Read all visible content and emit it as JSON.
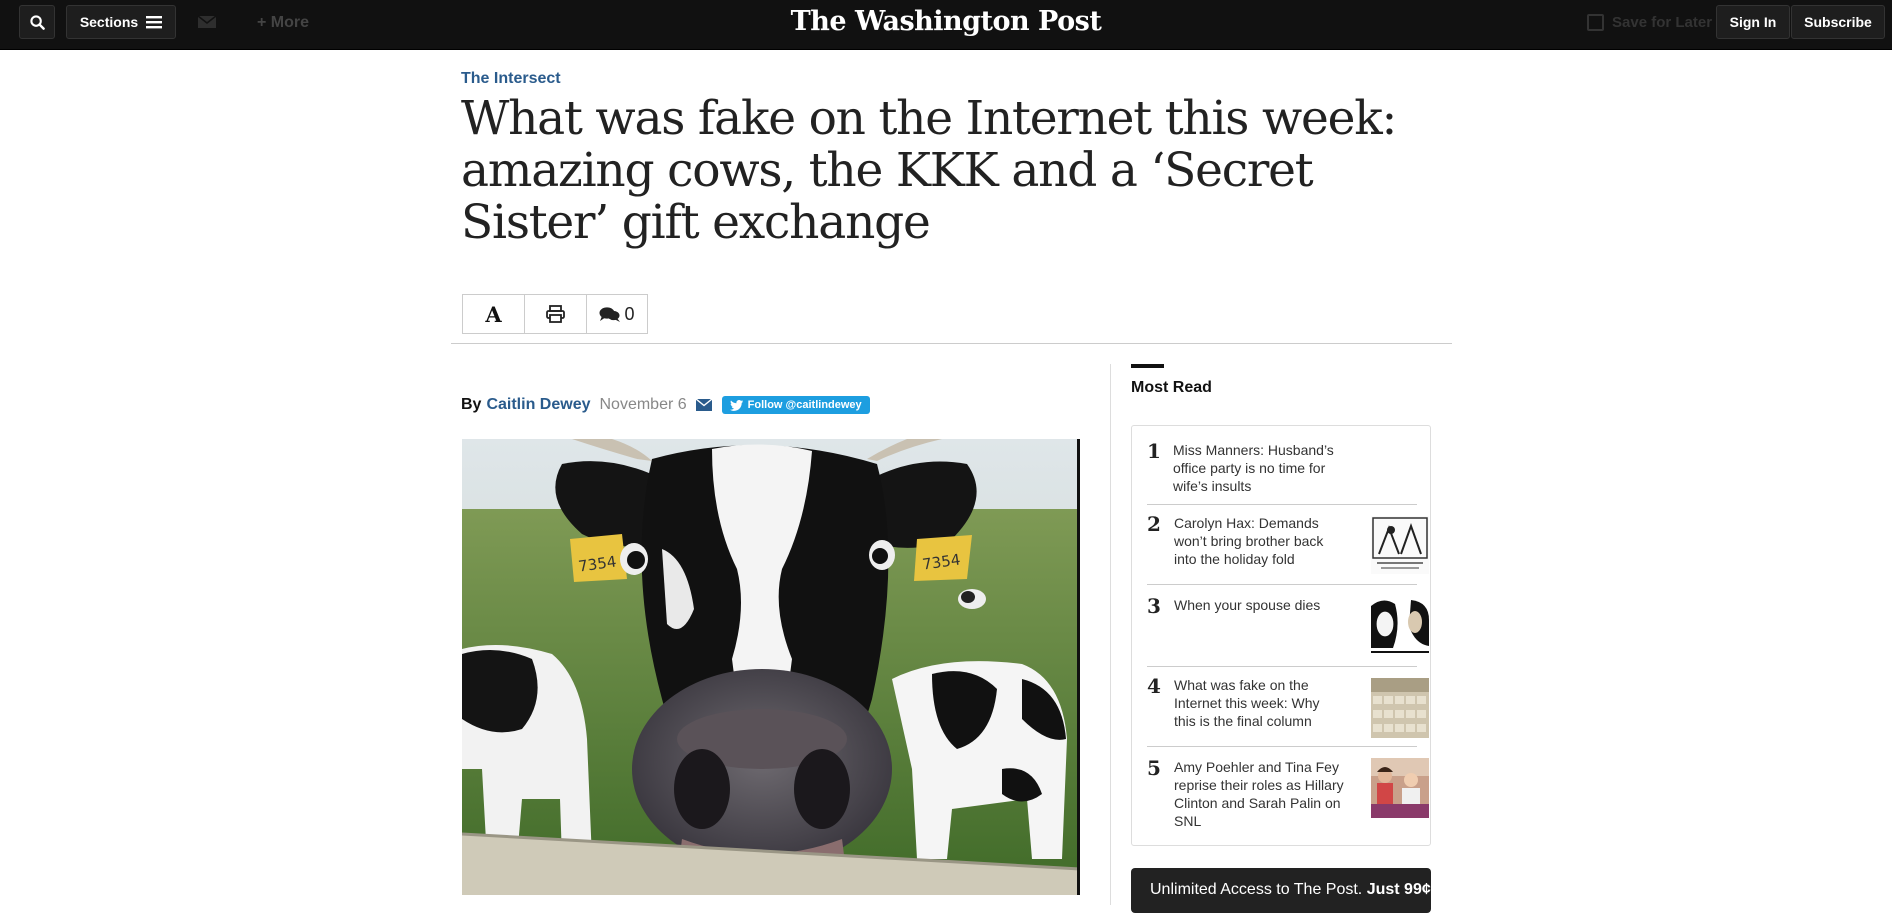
{
  "topbar": {
    "sections_label": "Sections",
    "more_label": "More",
    "logo": "The Washington Post",
    "save_label": "Save for Later",
    "signin_label": "Sign In",
    "subscribe_label": "Subscribe"
  },
  "article": {
    "kicker": "The Intersect",
    "headline": "What was fake on the Internet this week: amazing cows, the KKK and a ‘Secret Sister’ gift exchange",
    "comment_count": "0",
    "byline_prefix": "By",
    "author": "Caitlin Dewey",
    "date": "November 6",
    "follow_label": "Follow @caitlindewey",
    "photo_tag_text": "7354"
  },
  "most_read": {
    "title": "Most Read",
    "items": [
      {
        "num": "1",
        "text": "Miss Manners: Husband’s office party is no time for wife’s insults"
      },
      {
        "num": "2",
        "text": "Carolyn Hax: Demands won’t bring brother back into the holiday fold"
      },
      {
        "num": "3",
        "text": "When your spouse dies"
      },
      {
        "num": "4",
        "text": "What was fake on the Internet this week: Why this is the final column"
      },
      {
        "num": "5",
        "text": "Amy Poehler and Tina Fey reprise their roles as Hillary Clinton and Sarah Palin on SNL"
      }
    ]
  },
  "promo": {
    "text": "Unlimited Access to The Post.",
    "price": "Just 99¢"
  },
  "colors": {
    "topbar": "#111111",
    "link_blue": "#2a5b8c",
    "twitter_blue": "#1d9ee0"
  }
}
